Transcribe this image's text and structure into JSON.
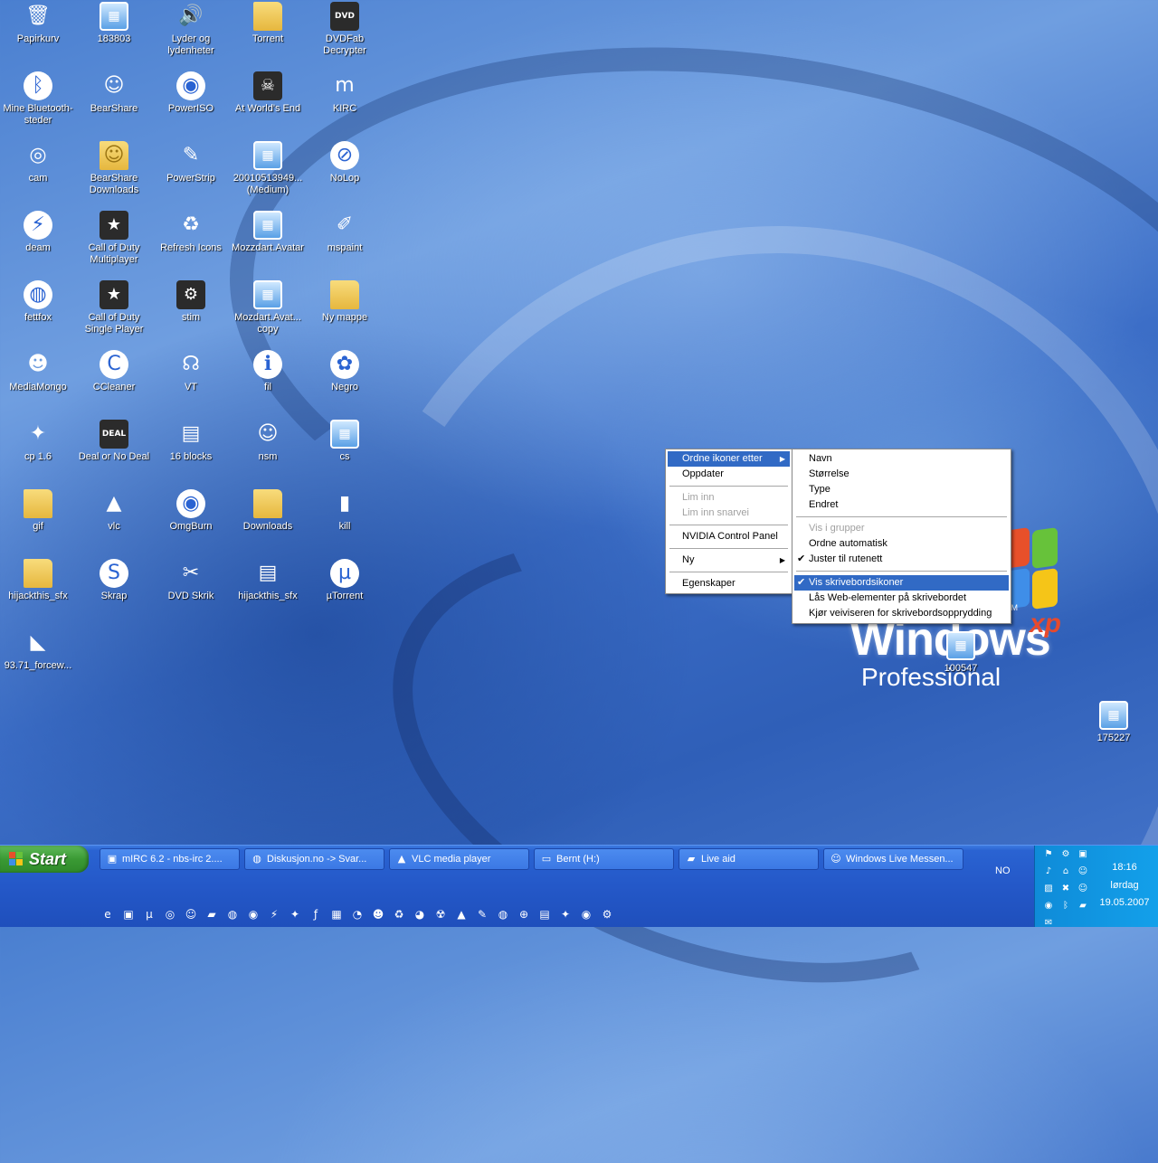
{
  "desktop": {
    "icons": [
      {
        "label": "Papirkurv",
        "glyph": "🗑",
        "kind": "plain"
      },
      {
        "label": "183803",
        "glyph": "▦",
        "kind": "img"
      },
      {
        "label": "Lyder og lydenheter",
        "glyph": "🔊",
        "kind": "plain"
      },
      {
        "label": "Torrent",
        "glyph": "",
        "kind": "folder"
      },
      {
        "label": "DVDFab Decrypter",
        "glyph": "DVD",
        "kind": "app"
      },
      {
        "label": "Mine Bluetooth-steder",
        "glyph": "ᛒ",
        "kind": "round"
      },
      {
        "label": "BearShare",
        "glyph": "☺",
        "kind": "plain"
      },
      {
        "label": "PowerISO",
        "glyph": "◉",
        "kind": "round"
      },
      {
        "label": "At World's End",
        "glyph": "☠",
        "kind": "app"
      },
      {
        "label": "KIRC",
        "glyph": "m",
        "kind": "plain"
      },
      {
        "label": "cam",
        "glyph": "◎",
        "kind": "plain"
      },
      {
        "label": "BearShare Downloads",
        "glyph": "☺",
        "kind": "folder"
      },
      {
        "label": "PowerStrip",
        "glyph": "✎",
        "kind": "plain"
      },
      {
        "label": "20010513949... (Medium)",
        "glyph": "▦",
        "kind": "img"
      },
      {
        "label": "NoLop",
        "glyph": "⊘",
        "kind": "round"
      },
      {
        "label": "deam",
        "glyph": "⚡",
        "kind": "round"
      },
      {
        "label": "Call of Duty Multiplayer",
        "glyph": "★",
        "kind": "app"
      },
      {
        "label": "Refresh Icons",
        "glyph": "♻",
        "kind": "plain"
      },
      {
        "label": "Mozzdart.Avatar",
        "glyph": "▦",
        "kind": "img"
      },
      {
        "label": "mspaint",
        "glyph": "✐",
        "kind": "plain"
      },
      {
        "label": "fettfox",
        "glyph": "◍",
        "kind": "round"
      },
      {
        "label": "Call of Duty Single Player",
        "glyph": "★",
        "kind": "app"
      },
      {
        "label": "stim",
        "glyph": "⚙",
        "kind": "app"
      },
      {
        "label": "Mozdart.Avat... copy",
        "glyph": "▦",
        "kind": "img"
      },
      {
        "label": "Ny mappe",
        "glyph": "",
        "kind": "folder"
      },
      {
        "label": "MediaMongo",
        "glyph": "☻",
        "kind": "plain"
      },
      {
        "label": "CCleaner",
        "glyph": "C",
        "kind": "round"
      },
      {
        "label": "VT",
        "glyph": "☊",
        "kind": "plain"
      },
      {
        "label": "fil",
        "glyph": "ℹ",
        "kind": "round"
      },
      {
        "label": "Negro",
        "glyph": "✿",
        "kind": "round"
      },
      {
        "label": "cp 1.6",
        "glyph": "✦",
        "kind": "plain"
      },
      {
        "label": "Deal or No Deal",
        "glyph": "DEAL",
        "kind": "app"
      },
      {
        "label": "16 blocks",
        "glyph": "▤",
        "kind": "plain"
      },
      {
        "label": "nsm",
        "glyph": "☺",
        "kind": "plain"
      },
      {
        "label": "cs",
        "glyph": "▦",
        "kind": "img"
      },
      {
        "label": "gif",
        "glyph": "",
        "kind": "folder"
      },
      {
        "label": "vlc",
        "glyph": "▲",
        "kind": "plain"
      },
      {
        "label": "OmgBurn",
        "glyph": "◉",
        "kind": "round"
      },
      {
        "label": "Downloads",
        "glyph": "",
        "kind": "folder"
      },
      {
        "label": "kill",
        "glyph": "▮",
        "kind": "plain"
      },
      {
        "label": "hijackthis_sfx",
        "glyph": "",
        "kind": "folder"
      },
      {
        "label": "Skrap",
        "glyph": "S",
        "kind": "round"
      },
      {
        "label": "DVD Skrik",
        "glyph": "✂",
        "kind": "plain"
      },
      {
        "label": "hijackthis_sfx",
        "glyph": "▤",
        "kind": "plain"
      },
      {
        "label": "µTorrent",
        "glyph": "µ",
        "kind": "round"
      },
      {
        "label": "93.71_forcew...",
        "glyph": "◣",
        "kind": "plain"
      }
    ],
    "extra_icons": [
      {
        "label": "100547",
        "glyph": "▦",
        "kind": "img"
      },
      {
        "label": "175227",
        "glyph": "▦",
        "kind": "img"
      }
    ],
    "wallpaper": {
      "brand_word": "Windows",
      "brand_xp": "xp",
      "brand_tm": "TM",
      "brand_edition": "Professional"
    }
  },
  "context_menu": {
    "items": [
      {
        "label": "Ordne ikoner etter",
        "state": "selected",
        "submenu": true
      },
      {
        "label": "Oppdater",
        "state": "normal"
      },
      {
        "sep": true
      },
      {
        "label": "Lim inn",
        "state": "disabled"
      },
      {
        "label": "Lim inn snarvei",
        "state": "disabled"
      },
      {
        "sep": true
      },
      {
        "label": "NVIDIA Control Panel",
        "state": "normal"
      },
      {
        "sep": true
      },
      {
        "label": "Ny",
        "state": "normal",
        "submenu": true
      },
      {
        "sep": true
      },
      {
        "label": "Egenskaper",
        "state": "normal"
      }
    ]
  },
  "submenu": {
    "items": [
      {
        "label": "Navn",
        "state": "normal"
      },
      {
        "label": "Størrelse",
        "state": "normal"
      },
      {
        "label": "Type",
        "state": "normal"
      },
      {
        "label": "Endret",
        "state": "normal"
      },
      {
        "sep": true
      },
      {
        "label": "Vis i grupper",
        "state": "disabled"
      },
      {
        "label": "Ordne automatisk",
        "state": "normal"
      },
      {
        "label": "Juster til rutenett",
        "state": "normal",
        "checked": true
      },
      {
        "sep": true
      },
      {
        "label": "Vis skrivebordsikoner",
        "state": "selected",
        "checked": true
      },
      {
        "label": "Lås Web-elementer på skrivebordet",
        "state": "normal"
      },
      {
        "label": "Kjør veiviseren for skrivebordsopprydding",
        "state": "normal"
      }
    ]
  },
  "taskbar": {
    "start_label": "Start",
    "tasks": [
      {
        "label": "mIRC 6.2 - nbs-irc 2....",
        "glyph": "▣"
      },
      {
        "label": "Diskusjon.no -> Svar...",
        "glyph": "◍"
      },
      {
        "label": "VLC media player",
        "glyph": "▲"
      },
      {
        "label": "Bernt (H:)",
        "glyph": "▭"
      },
      {
        "label": "Live aid",
        "glyph": "▰"
      },
      {
        "label": "Windows Live Messen...",
        "glyph": "☺"
      }
    ],
    "language": "NO",
    "clock": {
      "time": "18:16",
      "day": "lørdag",
      "date": "19.05.2007"
    },
    "quick_launch": [
      "e",
      "▣",
      "µ",
      "◎",
      "☺",
      "▰",
      "◍",
      "◉",
      "⚡",
      "✦",
      "ƒ",
      "▦",
      "◔",
      "☻",
      "♻",
      "◕",
      "☢",
      "▲",
      "✎",
      "◍",
      "⊕",
      "▤",
      "✦",
      "◉",
      "⚙"
    ],
    "tray_icons": [
      "⚑",
      "⚙",
      "▣",
      "♪",
      "⌂",
      "☺",
      "▨",
      "✖",
      "☺",
      "◉",
      "ᛒ",
      "▰",
      "✉"
    ]
  },
  "colors": {
    "menu_highlight": "#316ac5",
    "taskbar": "#2458c8",
    "start_green": "#3a9a34",
    "tray": "#13a0ea"
  }
}
